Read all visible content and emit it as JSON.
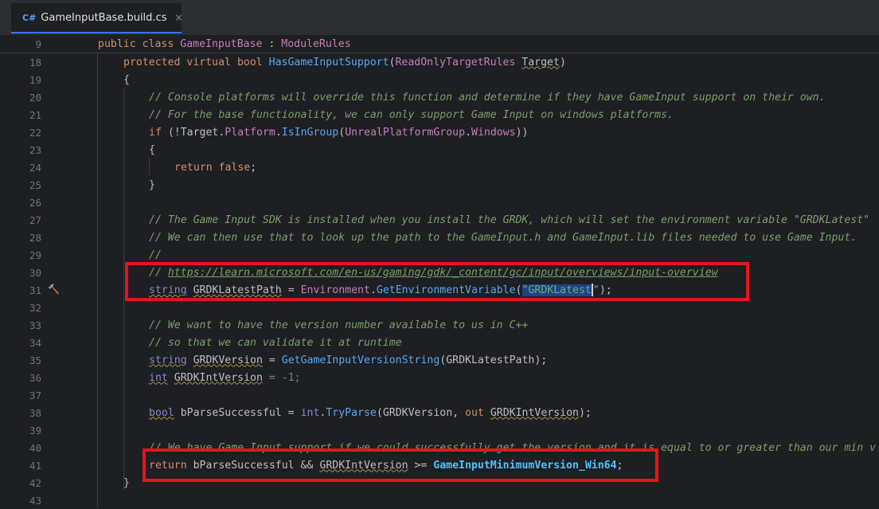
{
  "tab": {
    "lang_badge": "C#",
    "title": "GameInputBase.build.cs",
    "close": "×"
  },
  "sticky": {
    "line": "9",
    "kw1": "public",
    "kw2": "class",
    "name": "GameInputBase",
    "sep": " : ",
    "base": "ModuleRules"
  },
  "lines": {
    "l18": {
      "n": "18",
      "a": "protected",
      "b": "virtual",
      "c": "bool",
      "d": "HasGameInputSupport",
      "e": "(",
      "f": "ReadOnlyTargetRules",
      "g": "Target",
      "h": ")"
    },
    "l19": {
      "n": "19",
      "t": "{"
    },
    "l20": {
      "n": "20",
      "t": "// Console platforms will override this function and determine if they have GameInput support on their own."
    },
    "l21": {
      "n": "21",
      "t": "// For the base functionality, we can only support Game Input on windows platforms."
    },
    "l22": {
      "n": "22",
      "a": "if",
      "b": " (!Target.",
      "c": "Platform",
      "d": ".",
      "e": "IsInGroup",
      "f": "(",
      "g": "UnrealPlatformGroup",
      "h": ".",
      "i": "Windows",
      "j": "))"
    },
    "l23": {
      "n": "23",
      "t": "{"
    },
    "l24": {
      "n": "24",
      "a": "return",
      "b": "false",
      "c": ";"
    },
    "l25": {
      "n": "25",
      "t": "}"
    },
    "l26": {
      "n": "26"
    },
    "l27": {
      "n": "27",
      "t": "// The Game Input SDK is installed when you install the GRDK, which will set the environment variable \"GRDKLatest\""
    },
    "l28": {
      "n": "28",
      "t": "// We can then use that to look up the path to the GameInput.h and GameInput.lib files needed to use Game Input."
    },
    "l29": {
      "n": "29",
      "t": "//"
    },
    "l30": {
      "n": "30",
      "a": "// ",
      "b": "https://learn.microsoft.com/en-us/gaming/gdk/_content/gc/input/overviews/input-overview"
    },
    "l31": {
      "n": "31",
      "a": "string",
      "b": "GRDKLatestPath",
      "c": " = ",
      "d": "Environment",
      "e": ".",
      "f": "GetEnvironmentVariable",
      "g": "(",
      "h": "\"",
      "i": "GRDKLatest",
      "j": "\"",
      "k": ");"
    },
    "l32": {
      "n": "32"
    },
    "l33": {
      "n": "33",
      "t": "// We want to have the version number available to us in C++"
    },
    "l34": {
      "n": "34",
      "t": "// so that we can validate it at runtime"
    },
    "l35": {
      "n": "35",
      "a": "string",
      "b": "GRDKVersion",
      "c": " = ",
      "d": "GetGameInputVersionString",
      "e": "(GRDKLatestPath);"
    },
    "l36": {
      "n": "36",
      "a": "int",
      "b": "GRDKIntVersion",
      "c": " = ",
      "d": "-1",
      "e": ";"
    },
    "l37": {
      "n": "37"
    },
    "l38": {
      "n": "38",
      "a": "bool",
      "b": " bParseSuccessful = ",
      "c": "int",
      "d": ".",
      "e": "TryParse",
      "f": "(GRDKVersion, ",
      "g": "out",
      "h": " ",
      "i": "GRDKIntVersion",
      "j": ");"
    },
    "l39": {
      "n": "39"
    },
    "l40": {
      "n": "40",
      "t": "// We have Game Input support if we could successfully get the version and it is equal to or greater than our min v"
    },
    "l41": {
      "n": "41",
      "a": "return",
      "b": " bParseSuccessful && ",
      "c": "GRDKIntVersion",
      "d": " >= ",
      "e": "GameInputMinimumVersion_Win64",
      "f": ";"
    },
    "l42": {
      "n": "42",
      "t": "}"
    },
    "l43": {
      "n": "43"
    }
  }
}
